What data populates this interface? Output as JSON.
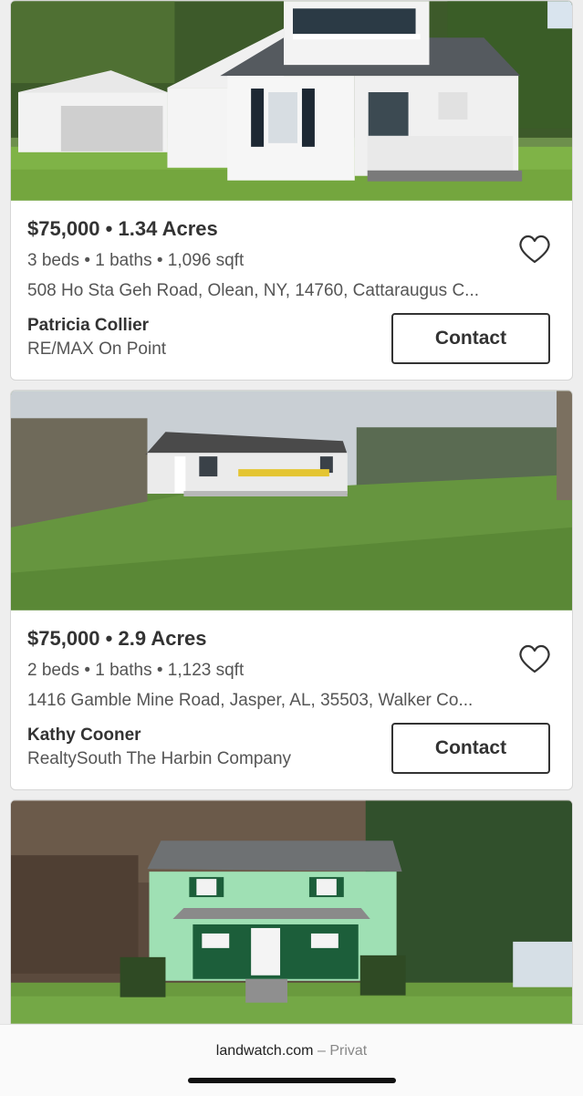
{
  "listings": [
    {
      "price": "$75,000",
      "sep": "•",
      "acres": "1.34 Acres",
      "stats": "3 beds • 1 baths • 1,096 sqft",
      "address": "508 Ho Sta Geh Road, Olean, NY, 14760, Cattaraugus C...",
      "agent": "Patricia Collier",
      "office": "RE/MAX On Point",
      "contact_label": "Contact",
      "favorite_icon": "heart-outline-icon"
    },
    {
      "price": "$75,000",
      "sep": "•",
      "acres": "2.9 Acres",
      "stats": "2 beds • 1 baths • 1,123 sqft",
      "address": "1416 Gamble Mine Road, Jasper, AL, 35503, Walker Co...",
      "agent": "Kathy Cooner",
      "office": "RealtySouth The Harbin Company",
      "contact_label": "Contact",
      "favorite_icon": "heart-outline-icon"
    }
  ],
  "browser": {
    "domain": "landwatch.com",
    "separator": "–",
    "mode": "Privat"
  },
  "colors": {
    "page_bg": "#eeeeee",
    "text_dark": "#333333",
    "text_muted": "#555555"
  }
}
